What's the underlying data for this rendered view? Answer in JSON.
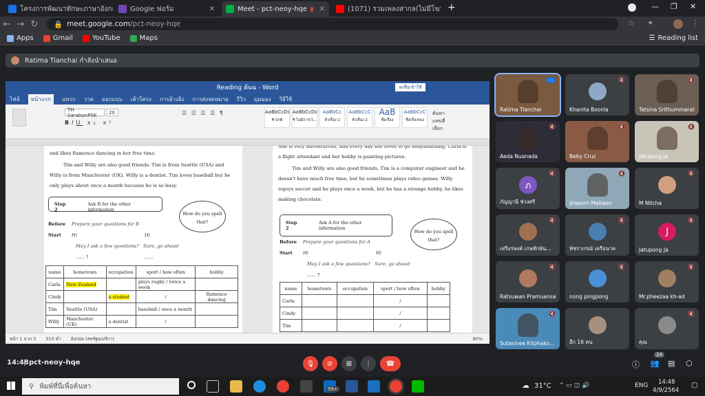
{
  "browser": {
    "tabs": [
      {
        "title": "โครงการพัฒนาทักษะภาษาอังกฤษเพื่อ",
        "color": "#1a73e8"
      },
      {
        "title": "Google ฟอร์ม",
        "color": "#7248b9"
      },
      {
        "title": "Meet - pct-neoy-hqe",
        "color": "#00ac47"
      },
      {
        "title": "(1071) รวมเพลงสากล(ไม่มีโฆษณา) ม",
        "color": "#ff0000"
      }
    ],
    "url_host": "meet.google.com",
    "url_path": "/pct-neoy-hqe",
    "bookmarks": [
      "Apps",
      "Gmail",
      "YouTube",
      "Maps"
    ],
    "reading_list": "Reading list"
  },
  "meet": {
    "presenter": "Ratima Tianchai กำลังนำเสนอ",
    "time": "14:48",
    "code": "pct-neoy-hqe",
    "more_count": "24",
    "participants": [
      {
        "name": "Ratima Tianchai",
        "bg": "#7a5a40"
      },
      {
        "name": "Khanita Boonla",
        "bg": "#3c4043",
        "avatar": "#8fa8c8"
      },
      {
        "name": "Tatsina Srithummarat",
        "bg": "#6b5e54"
      },
      {
        "name": "Aeda Nuanada",
        "bg": "#2d2d3a"
      },
      {
        "name": "Beby Cruz",
        "bg": "#8a5a45"
      },
      {
        "name": "Jatupong Ja",
        "bg": "#c9c4b8"
      },
      {
        "name": "ภัญญานี ช่วงศรี",
        "bg": "#3c4043",
        "avatar": "#7e57c2",
        "letter": "ภ"
      },
      {
        "name": "Jiraporn Maliwan",
        "bg": "#8ea8b8"
      },
      {
        "name": "M Nitcha",
        "bg": "#3c4043",
        "avatar": "#d0a080"
      },
      {
        "name": "เสรีอรพงค์ เกษทักษัน...",
        "bg": "#3c4043",
        "avatar": "#a07050"
      },
      {
        "name": "พัชราภรณ์ เครือนาค",
        "bg": "#3c4043",
        "avatar": "#4a7fb0"
      },
      {
        "name": "Jatupong Ja",
        "bg": "#3c4043",
        "avatar": "#d81b60",
        "letter": "J"
      },
      {
        "name": "Ratsuwan Pramuansab",
        "bg": "#3c4043",
        "avatar": "#b07a60"
      },
      {
        "name": "nong pingpong",
        "bg": "#3c4043",
        "avatar": "#4a90d9"
      },
      {
        "name": "Mr.pheezaa kh-ad",
        "bg": "#3c4043",
        "avatar": "#a08060"
      },
      {
        "name": "Sutasinee Kitphako...",
        "bg": "#4a8ab8"
      },
      {
        "name": "อีก 16 คน",
        "bg": "#3c4043",
        "avatar": "#a89080"
      },
      {
        "name": "คุณ",
        "bg": "#3c4043",
        "avatar": "#8a8a8a"
      }
    ]
  },
  "word": {
    "title": "Reading ต้นฉ - Word",
    "tabs": [
      "ไฟล์",
      "หน้าแรก",
      "แทรก",
      "วาด",
      "ออกแบบ",
      "เค้าโครง",
      "การอ้างอิง",
      "การส่งจดหมาย",
      "รีวิว",
      "มุมมอง",
      "วิธีใช้"
    ],
    "font": "TH SarabunPSK",
    "size": "20",
    "styles": [
      "AaBbCcDc",
      "AaBbCcDc",
      "AaBbCc",
      "AaBbCcC",
      "AaB",
      "AaBbCcC"
    ],
    "style_names": [
      "¶ ปกติ",
      "¶ ไม่มีการเว้...",
      "หัวเรื่อง 1",
      "หัวเรื่อง 2",
      "ชื่อเรื่อง",
      "ชื่อเรื่องรอง"
    ],
    "page1": {
      "lines": [
        "and likes flamenco dancing in her free time.",
        "Tim and Willy are also good friends. Tim is from Seattle (USA) and Willy is from Manchester (UK). Willy is a dentist. Tim loves baseball but he only plays about once a month because he is so busy."
      ],
      "step": "Step 2",
      "step_text": "Ask B for the other information",
      "cloud": "How do you spell that?",
      "before": "Before",
      "before_text": "Prepare your questions for B",
      "start": "Start",
      "hi": "Hi",
      "hi2": "Hi",
      "ask": "May I ask a few questions?",
      "sure": "Sure, go ahead",
      "dots": "...... ?",
      "dots2": "......",
      "headers": [
        "name",
        "hometown",
        "occupation",
        "sport  /  how often",
        "hobby"
      ],
      "rows": [
        [
          "Carla",
          "New Zealand",
          "",
          "plays rugby / twice a week",
          ""
        ],
        [
          "Cindy",
          "",
          "a student",
          "/",
          "flamenco dancing"
        ],
        [
          "Tim",
          "Seattle (USA)",
          "",
          "baseball / once a month",
          ""
        ],
        [
          "Willy",
          "Manchester (UK)",
          "a dentist",
          "/",
          ""
        ]
      ]
    },
    "page2": {
      "lines": [
        "She is very adventurous, and every day she loves to go bodyboarding. Carla is a flight attendant and her hobby is painting pictures.",
        "Tim and Willy are also good friends. Tim is a computer engineer and he doesn't have much free time, but he sometimes plays video games. Willy enjoys soccer and he plays once a week, but he has a strange hobby, he likes making chocolate."
      ],
      "step": "Step 2",
      "step_text": "Ask A for the other information",
      "cloud": "How do you spell that?",
      "before": "Before",
      "before_text": "Prepare your questions for A",
      "start": "Start",
      "hi": "Hi",
      "hi2": "Hi",
      "ask": "May I ask a few questions?",
      "sure": "Sure, go ahead",
      "dots": "...... ?",
      "headers": [
        "name",
        "hometown",
        "occupation",
        "sport  /  how often",
        "hobby"
      ],
      "rows": [
        [
          "Carla",
          "",
          "",
          "/",
          ""
        ],
        [
          "Cindy",
          "",
          "",
          "/",
          ""
        ],
        [
          "Tim",
          "",
          "",
          "/",
          ""
        ]
      ]
    },
    "status": [
      "หน้า 1 จาก 3",
      "310 คำ",
      "อังกฤษ (สหรัฐอเมริกา)"
    ],
    "zoom": "80%"
  },
  "taskbar": {
    "search": "พิมพ์ที่นี่เพื่อค้นหา",
    "weather": "31°C",
    "lang": "ENG",
    "time": "14:48",
    "date": "4/9/2564",
    "badge": "99+"
  }
}
